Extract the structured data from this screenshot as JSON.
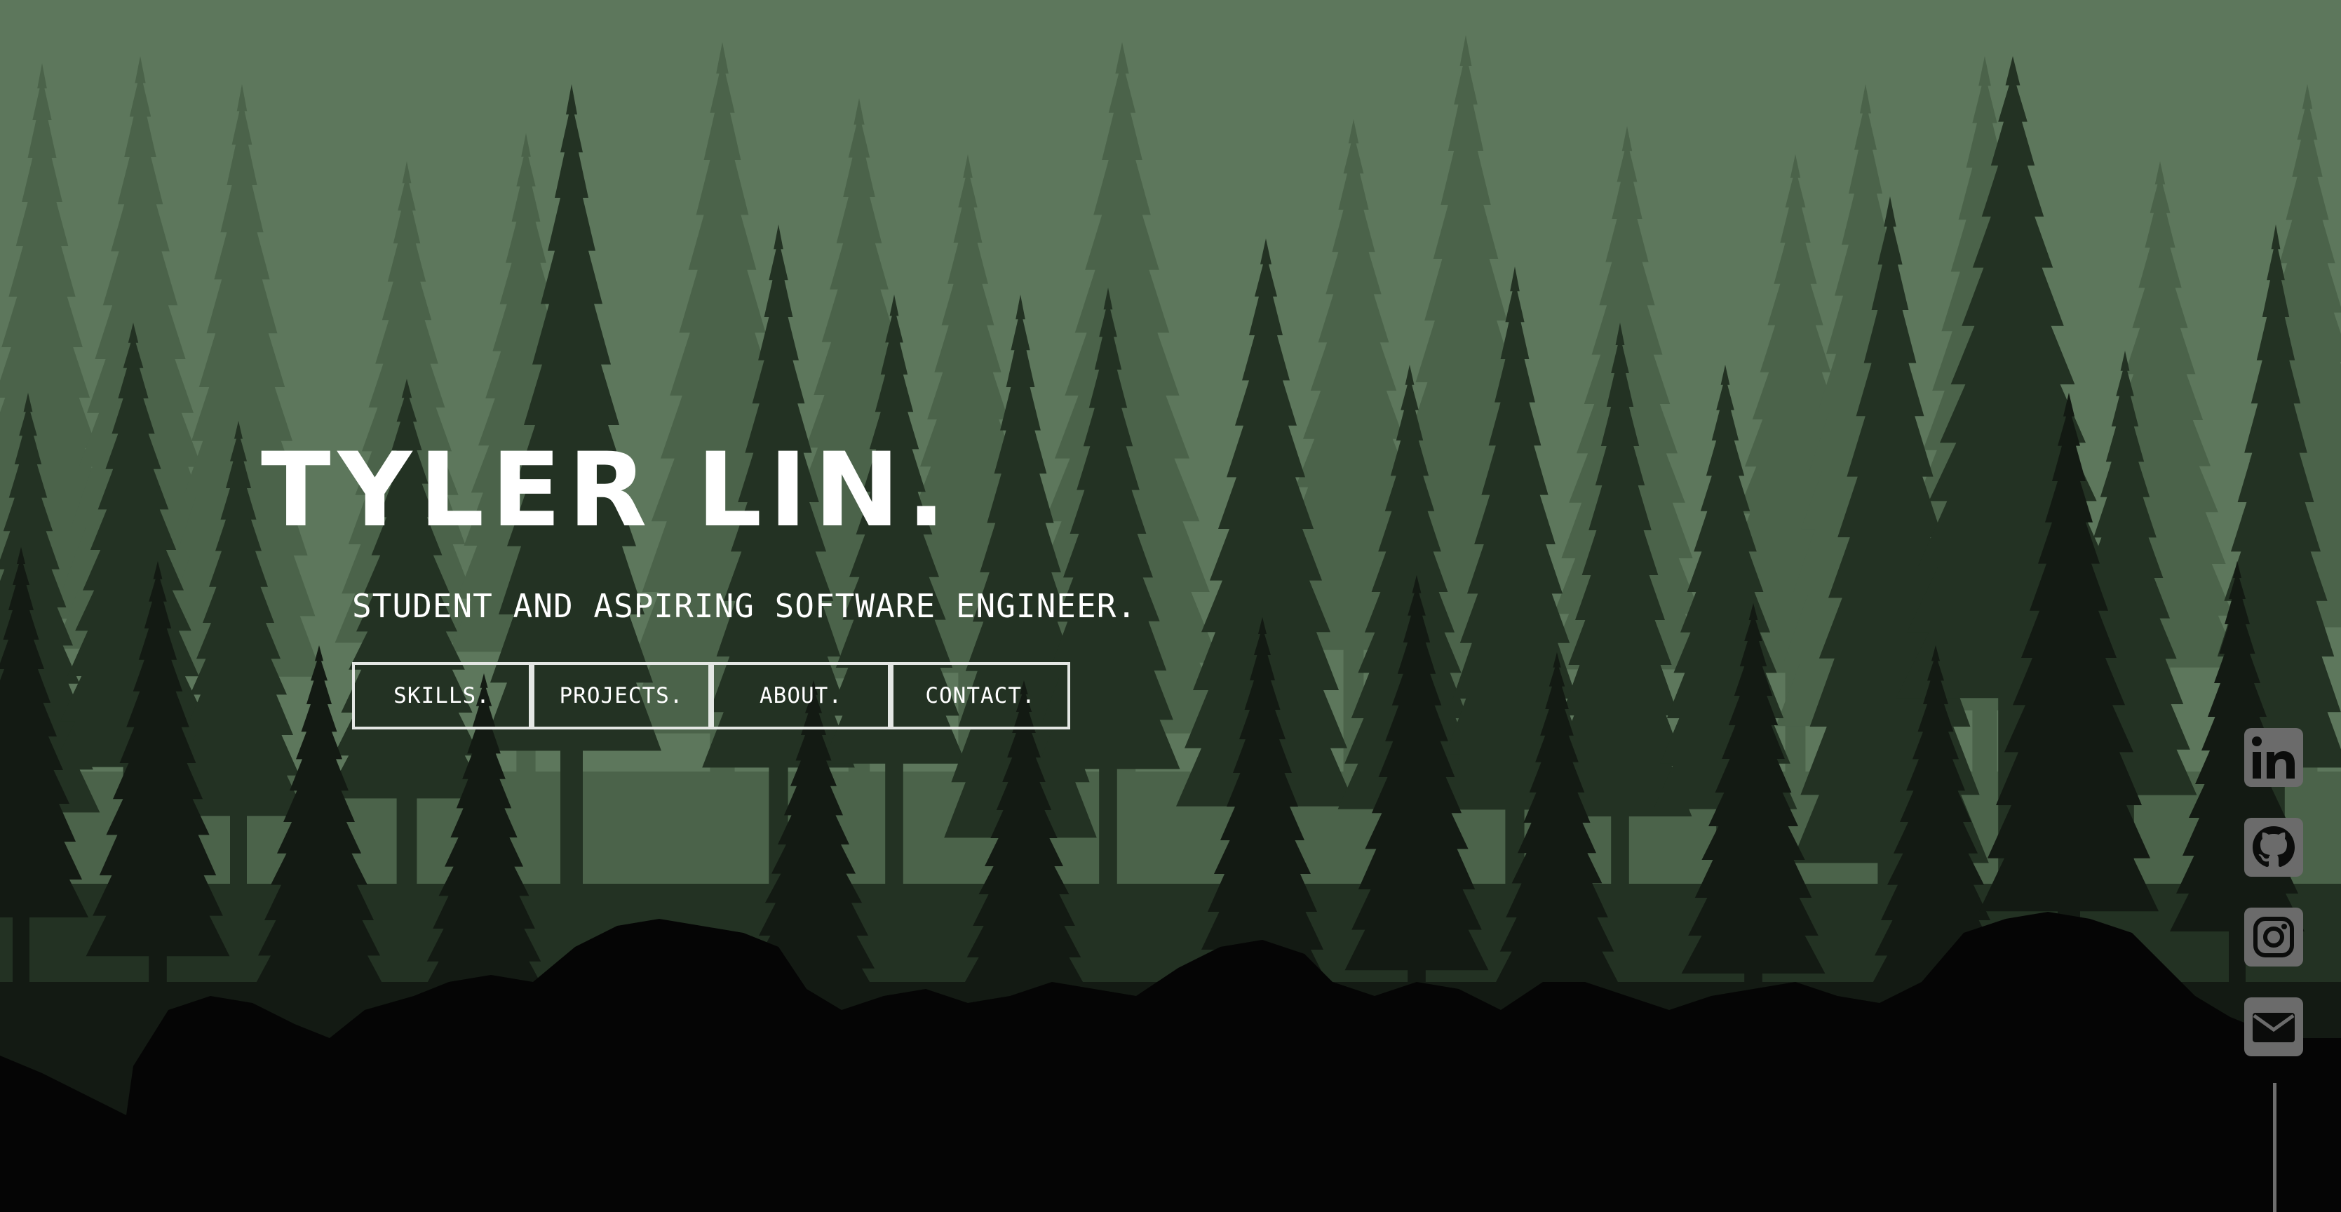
{
  "hero": {
    "title": "TYLER LIN.",
    "subtitle": "STUDENT AND ASPIRING SOFTWARE ENGINEER."
  },
  "nav": {
    "items": [
      {
        "label": "SKILLS."
      },
      {
        "label": "PROJECTS."
      },
      {
        "label": "ABOUT."
      },
      {
        "label": "CONTACT."
      }
    ]
  },
  "social": {
    "icons": [
      "linkedin-icon",
      "github-icon",
      "instagram-icon",
      "mail-icon"
    ]
  },
  "colors": {
    "sky": "#5d775c",
    "far_trees": "#4b634a",
    "mid_trees": "#233223",
    "near_trees": "#131a13",
    "ground": "#050505",
    "icon_fill": "#6b6b6b",
    "button_border": "#e4e7e4"
  }
}
